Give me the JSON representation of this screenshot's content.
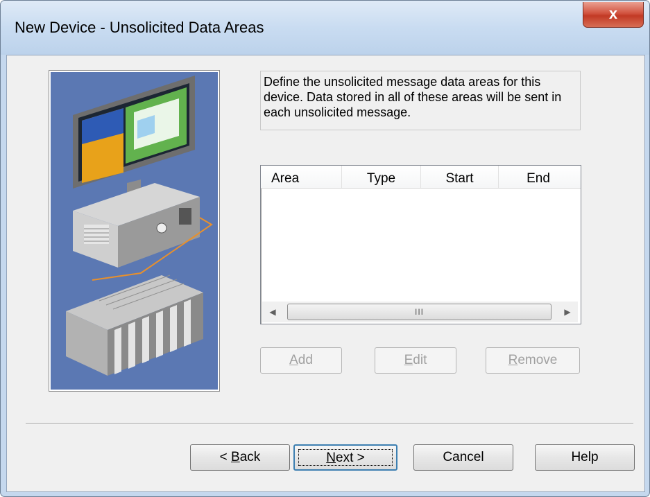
{
  "window": {
    "title": "New Device - Unsolicited Data Areas",
    "close_glyph": "x"
  },
  "description": "Define the unsolicited message data areas for this device.  Data stored in all of these areas will be sent in each unsolicited message.",
  "list": {
    "columns": [
      "Area",
      "Type",
      "Start",
      "End"
    ],
    "rows": [],
    "scroll_left_glyph": "◀",
    "scroll_right_glyph": "▶",
    "scroll_thumb_grip": "III"
  },
  "actions": {
    "add": {
      "prefix": "",
      "mnemonic": "A",
      "rest": "dd",
      "enabled": false
    },
    "edit": {
      "prefix": "",
      "mnemonic": "E",
      "rest": "dit",
      "enabled": false
    },
    "remove": {
      "prefix": "",
      "mnemonic": "R",
      "rest": "emove",
      "enabled": false
    }
  },
  "footer": {
    "back": {
      "prefix": "< ",
      "mnemonic": "B",
      "rest": "ack"
    },
    "next": {
      "prefix": "",
      "mnemonic": "N",
      "rest": "ext >"
    },
    "cancel": "Cancel",
    "help": "Help"
  },
  "colors": {
    "illustration_bg": "#5b78b3",
    "default_button_border": "#3c7fb1"
  },
  "icons": {
    "illustration": "pc-connected-to-plc-illustration"
  }
}
